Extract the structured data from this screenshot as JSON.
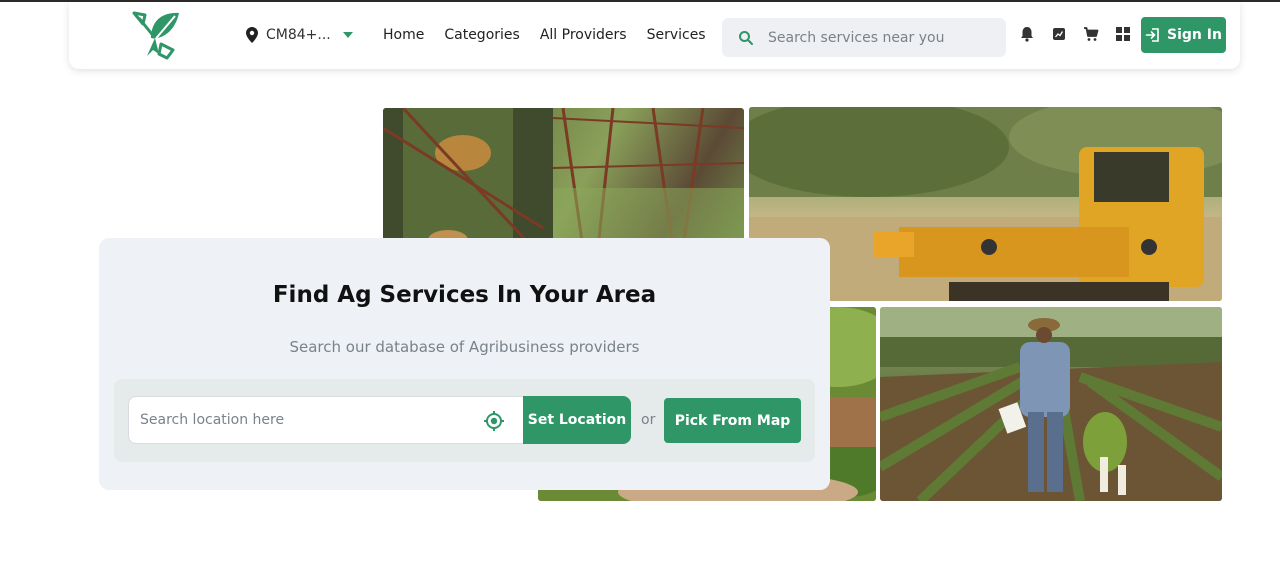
{
  "header": {
    "location_label": "CM84+...",
    "nav": [
      "Home",
      "Categories",
      "All Providers",
      "Services"
    ],
    "search_placeholder": "Search services near you",
    "signin_label": "Sign In"
  },
  "hero": {
    "title": "Find Ag Services In Your Area",
    "subtitle": "Search our database of Agribusiness providers",
    "location_placeholder": "Search location here",
    "set_location_label": "Set Location",
    "or_label": "or",
    "pick_map_label": "Pick From Map"
  },
  "colors": {
    "brand": "#2f9668",
    "card_bg": "#eef1f6",
    "muted_text": "#7a8289"
  },
  "icons": [
    "logo-leaf-shovel",
    "location-pin-icon",
    "chevron-down-icon",
    "search-icon",
    "bell-icon",
    "chart-icon",
    "cart-icon",
    "grid-icon",
    "sign-in-icon",
    "locate-target-icon"
  ]
}
